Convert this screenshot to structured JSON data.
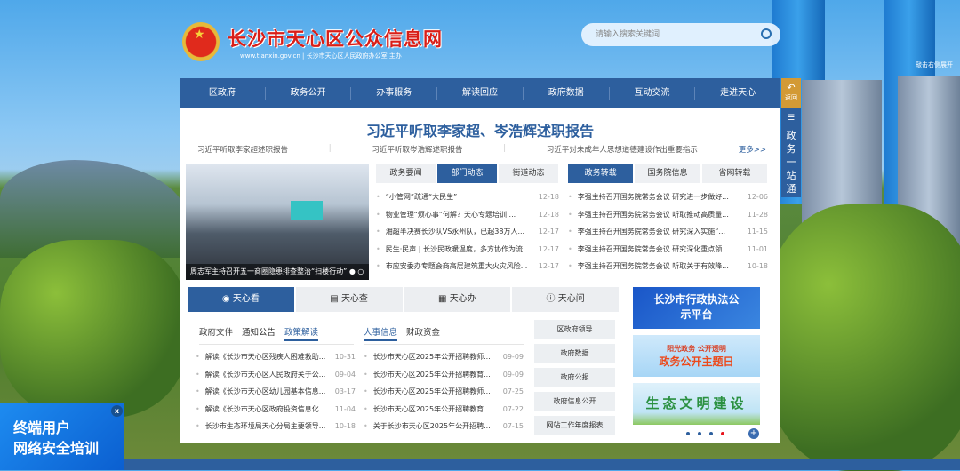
{
  "header": {
    "site_title": "长沙市天心区公众信息网",
    "domain": "www.tianxin.gov.cn",
    "org": "长沙市天心区人民政府办公室 主办",
    "search_placeholder": "请输入搜索关键词"
  },
  "nav": [
    "区政府",
    "政务公开",
    "办事服务",
    "解读回应",
    "政府数据",
    "互动交流",
    "走进天心"
  ],
  "side": {
    "back": "返回",
    "one_stop": "政务一站通",
    "hint": "敲击右侧展开"
  },
  "headline": {
    "title": "习近平听取李家超、岑浩辉述职报告",
    "subs": [
      "习近平听取李家超述职报告",
      "习近平听取岑浩辉述职报告",
      "习近平对未成年人思想道德建设作出重要指示"
    ],
    "more": "更多>>"
  },
  "photo_caption": "周志军主持召开五一商圈隐患排查整治“扫楼行动”",
  "news_left": {
    "tabs": [
      "政务要闻",
      "部门动态",
      "街道动态"
    ],
    "active": 1,
    "items": [
      {
        "t": "“小管网”疏通“大民生”",
        "d": "12-18"
      },
      {
        "t": "物业管理“烦心事”何解？天心专题培训 ...",
        "d": "12-18"
      },
      {
        "t": "湘超半决赛长沙队VS永州队，已超38万人...",
        "d": "12-17"
      },
      {
        "t": "民生·民声 | 长沙民政暖温度，多方协作为流...",
        "d": "12-17"
      },
      {
        "t": "市应安委办专题会商高层建筑重大火灾风险...",
        "d": "12-17"
      }
    ]
  },
  "news_right": {
    "tabs": [
      "政务转载",
      "国务院信息",
      "省网转载"
    ],
    "active": 0,
    "items": [
      {
        "t": "李强主持召开国务院常务会议 研究进一步做好...",
        "d": "12-06"
      },
      {
        "t": "李强主持召开国务院常务会议 听取推动高质量...",
        "d": "11-28"
      },
      {
        "t": "李强主持召开国务院常务会议 研究深入实施“...",
        "d": "11-15"
      },
      {
        "t": "李强主持召开国务院常务会议 研究深化重点领...",
        "d": "11-01"
      },
      {
        "t": "李强主持召开国务院常务会议 听取关于有效降...",
        "d": "10-18"
      }
    ]
  },
  "service_tabs": [
    "天心看",
    "天心查",
    "天心办",
    "天心问"
  ],
  "policy": {
    "tabs": [
      "政府文件",
      "通知公告",
      "政策解读"
    ],
    "active": 2,
    "items": [
      {
        "t": "解读《长沙市天心区残疾人困难救助...",
        "d": "10-31"
      },
      {
        "t": "解读《长沙市天心区人民政府关于公...",
        "d": "09-04"
      },
      {
        "t": "解读《长沙市天心区幼儿园基本信息...",
        "d": "03-17"
      },
      {
        "t": "解读《长沙市天心区政府投资信息化...",
        "d": "11-04"
      },
      {
        "t": "长沙市生态环境局天心分局主要领导...",
        "d": "10-18"
      }
    ]
  },
  "personnel": {
    "tabs": [
      "人事信息",
      "财政资金"
    ],
    "active": 0,
    "items": [
      {
        "t": "长沙市天心区2025年公开招聘教师...",
        "d": "09-09"
      },
      {
        "t": "长沙市天心区2025年公开招聘教育...",
        "d": "09-09"
      },
      {
        "t": "长沙市天心区2025年公开招聘教师...",
        "d": "07-25"
      },
      {
        "t": "长沙市天心区2025年公开招聘教育...",
        "d": "07-22"
      },
      {
        "t": "关于长沙市天心区2025年公开招聘...",
        "d": "07-15"
      }
    ]
  },
  "quick_links": [
    "区政府领导",
    "政府数据",
    "政府公报",
    "政府信息公开",
    "网站工作年度报表"
  ],
  "banners": {
    "b1": "长沙市行政执法公示平台",
    "b2a": "阳光政务 公开透明",
    "b2b": "政务公开主题日",
    "b3": "生态文明建设"
  },
  "ad": {
    "line1": "终端用户",
    "line2": "网络安全培训",
    "close": "x"
  }
}
